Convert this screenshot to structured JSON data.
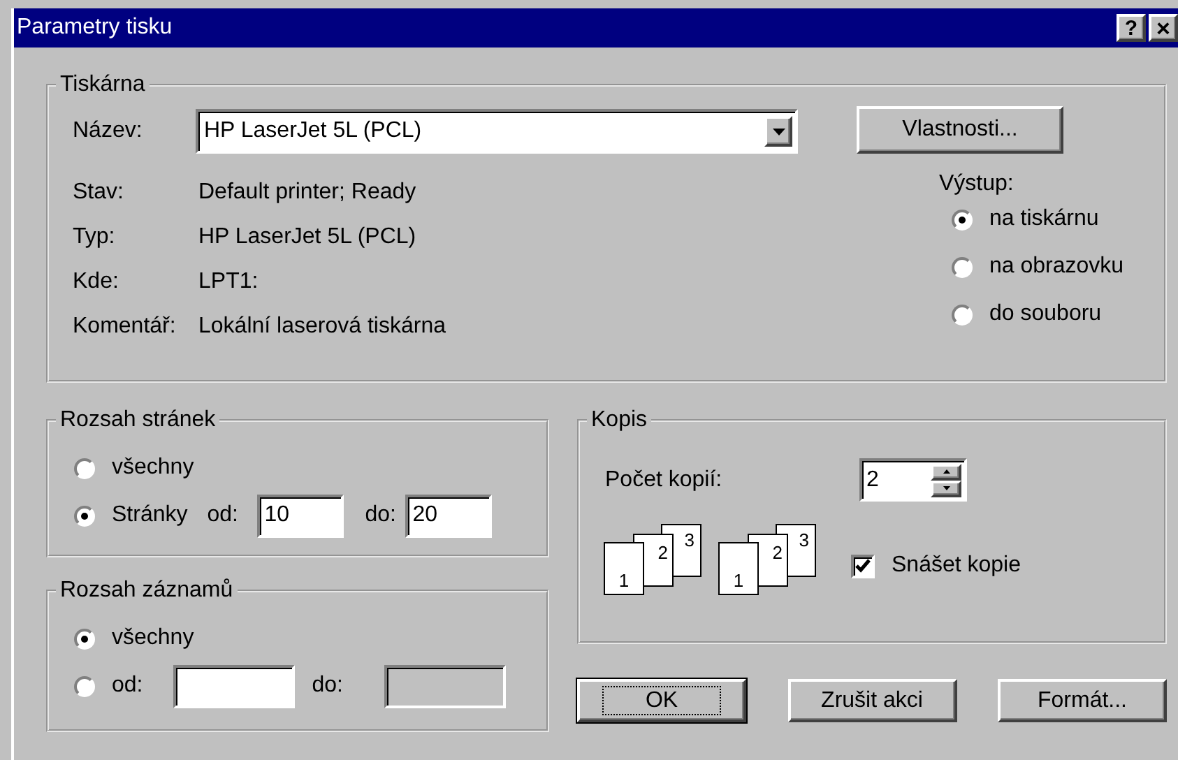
{
  "window": {
    "title": "Parametry tisku",
    "help_button": "?",
    "close_button": "×"
  },
  "printer_group": {
    "title": "Tiskárna",
    "name_label": "Název:",
    "name_value": "HP LaserJet 5L (PCL)",
    "properties_button": "Vlastnosti...",
    "info": [
      {
        "label": "Stav:",
        "value": "Default printer; Ready"
      },
      {
        "label": "Typ:",
        "value": "HP LaserJet 5L (PCL)"
      },
      {
        "label": "Kde:",
        "value": "LPT1:"
      },
      {
        "label": "Komentář:",
        "value": "Lokální laserová tiskárna"
      }
    ],
    "output": {
      "label": "Výstup:",
      "options": [
        {
          "label": "na tiskárnu",
          "selected": true
        },
        {
          "label": "na obrazovku",
          "selected": false
        },
        {
          "label": "do souboru",
          "selected": false
        }
      ]
    }
  },
  "page_range": {
    "title": "Rozsah stránek",
    "options": [
      {
        "label": "všechny",
        "selected": false
      },
      {
        "label": "Stránky",
        "selected": true
      }
    ],
    "from_label": "od:",
    "from_value": "10",
    "to_label": "do:",
    "to_value": "20"
  },
  "record_range": {
    "title": "Rozsah záznamů",
    "options": [
      {
        "label": "všechny",
        "selected": true
      },
      {
        "label": "od:",
        "selected": false
      }
    ],
    "to_label": "do:",
    "to_disabled": true
  },
  "copies": {
    "title": "Kopis",
    "count_label": "Počet kopií:",
    "count_value": "2",
    "stacks": [
      [
        "1",
        "2",
        "3"
      ],
      [
        "1",
        "2",
        "3"
      ]
    ],
    "collate_label": "Snášet kopie",
    "collate_checked": true
  },
  "buttons": [
    {
      "label": "OK",
      "default": true
    },
    {
      "label": "Zrušit akci",
      "default": false
    },
    {
      "label": "Formát...",
      "default": false
    }
  ]
}
